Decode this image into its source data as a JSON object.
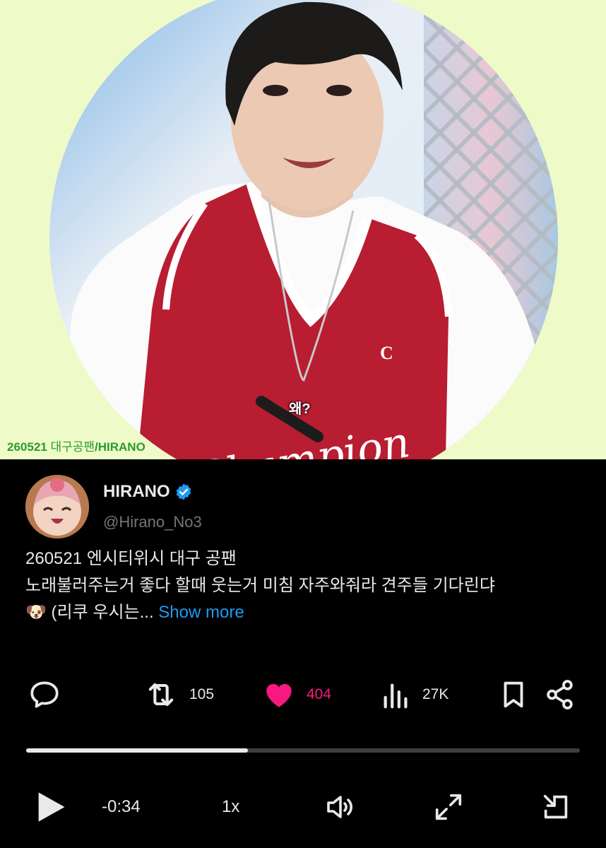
{
  "video": {
    "caption": "왜?",
    "watermark_date": "260521",
    "watermark_text": "대구공팬",
    "watermark_name": "/HIRANO"
  },
  "post": {
    "display_name": "HIRANO",
    "handle": "@Hirano_No3",
    "text_line1": "260521 엔시티위시 대구 공팬",
    "text_line2": "노래불러주는거 좋다 할때 웃는거 미침 자주와줘라 견주들 기다린댜",
    "text_line3_emoji": "🐶",
    "text_line3": " (리쿠 우시는...",
    "show_more": "Show more"
  },
  "actions": {
    "reply_icon": "reply-icon",
    "repost_icon": "repost-icon",
    "repost_count": "105",
    "like_icon": "heart-icon",
    "like_count": "404",
    "views_icon": "views-icon",
    "views_count": "27K",
    "bookmark_icon": "bookmark-icon",
    "share_icon": "share-icon",
    "like_color": "#f91880"
  },
  "player": {
    "progress": 0.4,
    "time_remaining": "-0:34",
    "speed": "1x"
  },
  "colors": {
    "background": "#000000",
    "accent": "#1d9bf0",
    "video_bg": "#eefbc9"
  }
}
